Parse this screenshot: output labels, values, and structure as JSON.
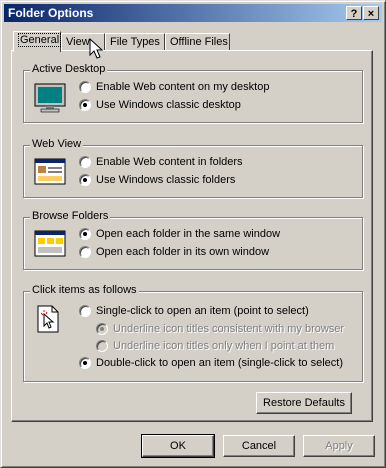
{
  "window": {
    "title": "Folder Options",
    "help_label": "?",
    "close_label": "×"
  },
  "tabs": [
    {
      "label": "General",
      "active": true
    },
    {
      "label": "View"
    },
    {
      "label": "File Types"
    },
    {
      "label": "Offline Files"
    }
  ],
  "groups": {
    "active_desktop": {
      "label": "Active Desktop",
      "icon": "desktop-icon",
      "options": [
        {
          "label": "Enable Web content on my desktop",
          "checked": false
        },
        {
          "label": "Use Windows classic desktop",
          "checked": true
        }
      ]
    },
    "web_view": {
      "label": "Web View",
      "icon": "folder-webview-icon",
      "options": [
        {
          "label": "Enable Web content in folders",
          "checked": false
        },
        {
          "label": "Use Windows classic folders",
          "checked": true
        }
      ]
    },
    "browse_folders": {
      "label": "Browse Folders",
      "icon": "browse-window-icon",
      "options": [
        {
          "label": "Open each folder in the same window",
          "checked": true
        },
        {
          "label": "Open each folder in its own window",
          "checked": false
        }
      ]
    },
    "click_items": {
      "label": "Click items as follows",
      "icon": "click-pointer-icon",
      "single_click": {
        "label": "Single-click to open an item (point to select)",
        "checked": false
      },
      "underline_consistent": {
        "label": "Underline icon titles consistent with my browser",
        "checked": true,
        "disabled": true
      },
      "underline_point": {
        "label": "Underline icon titles only when I point at them",
        "checked": false,
        "disabled": true
      },
      "double_click": {
        "label": "Double-click to open an item (single-click to select)",
        "checked": true
      }
    }
  },
  "buttons": {
    "restore_defaults": "Restore Defaults",
    "ok": "OK",
    "cancel": "Cancel",
    "apply": "Apply"
  }
}
